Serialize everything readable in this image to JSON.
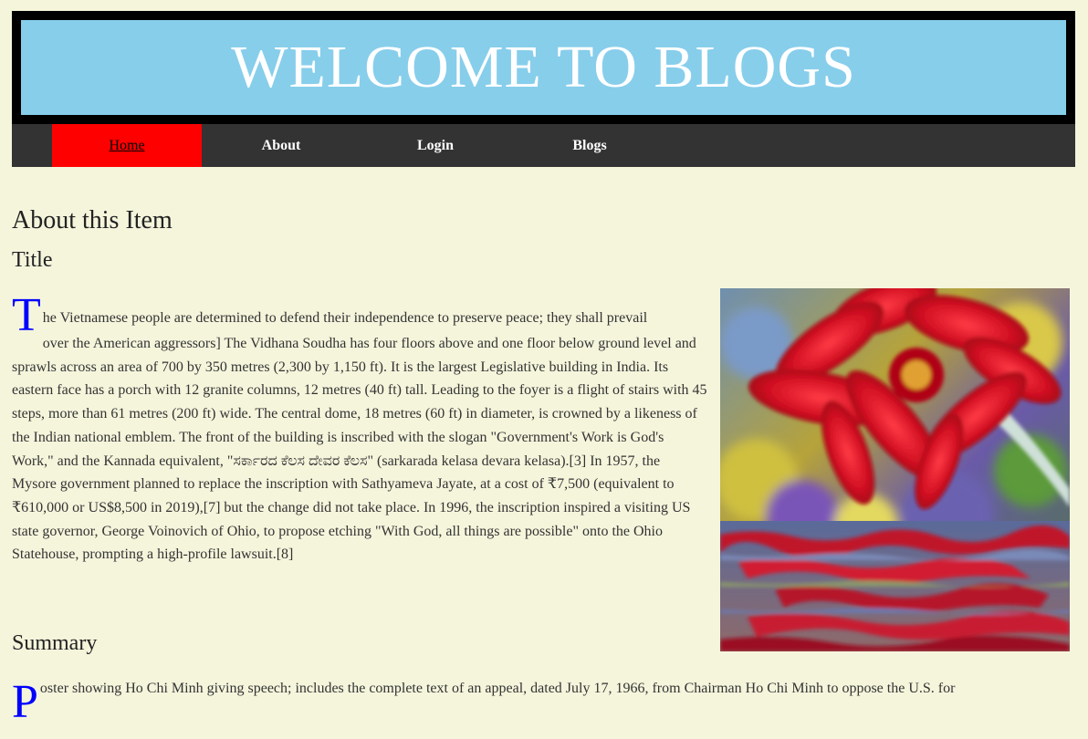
{
  "header": {
    "title": "WELCOME TO BLOGS"
  },
  "nav": {
    "items": [
      {
        "label": "Home",
        "active": true
      },
      {
        "label": "About",
        "active": false
      },
      {
        "label": "Login",
        "active": false
      },
      {
        "label": "Blogs",
        "active": false
      }
    ]
  },
  "main": {
    "heading": "About this Item",
    "title_heading": "Title",
    "title_dropcap": "T",
    "title_first_line": "he Vietnamese people are determined to defend their independence to preserve peace; they shall prevail",
    "title_body": "over the American aggressors] The Vidhana Soudha has four floors above and one floor below ground level and sprawls across an area of 700 by 350 metres (2,300 by 1,150 ft). It is the largest Legislative building in India. Its eastern face has a porch with 12 granite columns, 12 metres (40 ft) tall. Leading to the foyer is a flight of stairs with 45 steps, more than 61 metres (200 ft) wide. The central dome, 18 metres (60 ft) in diameter, is crowned by a likeness of the Indian national emblem. The front of the building is inscribed with the slogan \"Government's Work is God's Work,\" and the Kannada equivalent, \"ಸರ್ಕಾರದ ಕೆಲಸ ದೇವರ ಕೆಲಸ\" (sarkarada kelasa devara kelasa).[3] In 1957, the Mysore government planned to replace the inscription with Sathyameva Jayate, at a cost of ₹7,500 (equivalent to ₹610,000 or US$8,500 in 2019),[7] but the change did not take place. In 1996, the inscription inspired a visiting US state governor, George Voinovich of Ohio, to propose etching \"With God, all things are possible\" onto the Ohio Statehouse, prompting a high-profile lawsuit.[8]",
    "summary_heading": "Summary",
    "summary_dropcap": "P",
    "summary_text": "oster showing Ho Chi Minh giving speech; includes the complete text of an appeal, dated July 17, 1966, from Chairman Ho Chi Minh to oppose the U.S. for"
  },
  "colors": {
    "page_background": "#f5f5dc",
    "banner_background": "#87ceeb",
    "banner_border": "#000000",
    "nav_background": "#333333",
    "nav_active": "#ff0000",
    "dropcap": "#0000ff"
  },
  "image": {
    "subject": "red-gerbera-flower-reflected-in-water"
  }
}
